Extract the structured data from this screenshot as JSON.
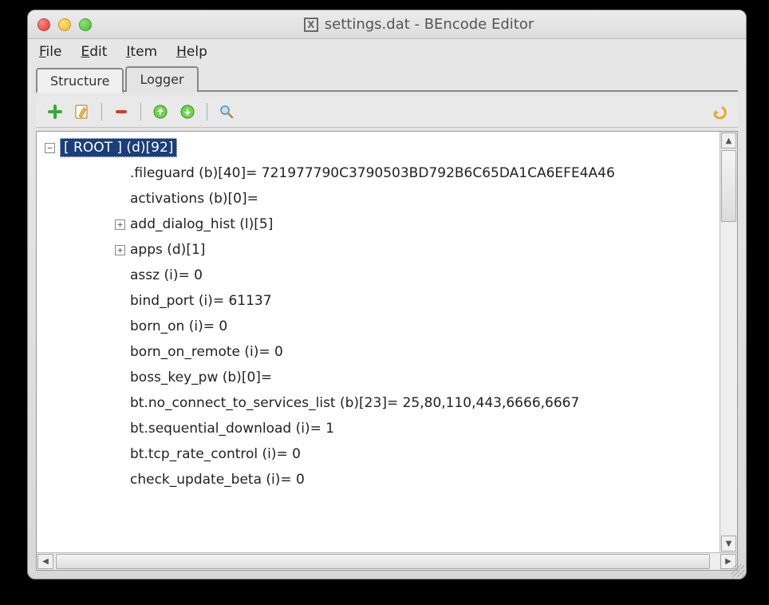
{
  "window": {
    "app_icon_letter": "X",
    "title": "settings.dat - BEncode Editor"
  },
  "menu": {
    "items": [
      {
        "key": "F",
        "rest": "ile"
      },
      {
        "key": "E",
        "rest": "dit"
      },
      {
        "key": "I",
        "rest": "tem"
      },
      {
        "key": "H",
        "rest": "elp"
      }
    ]
  },
  "tabs": {
    "items": [
      "Structure",
      "Logger"
    ],
    "active": 0
  },
  "toolbar": {
    "add": "add-icon",
    "edit": "edit-icon",
    "remove": "remove-icon",
    "up": "up-icon",
    "down": "down-icon",
    "find": "find-icon",
    "undo": "undo-icon"
  },
  "tree": {
    "root_label": "[ ROOT ] (d)[92]",
    "nodes": [
      {
        "expander": null,
        "indent": 2,
        "text": ".fileguard (b)[40]= 721977790C3790503BD792B6C65DA1CA6EFE4A46"
      },
      {
        "expander": null,
        "indent": 2,
        "text": "activations (b)[0]="
      },
      {
        "expander": "+",
        "indent": 2,
        "text": "add_dialog_hist (l)[5]"
      },
      {
        "expander": "+",
        "indent": 2,
        "text": "apps (d)[1]"
      },
      {
        "expander": null,
        "indent": 2,
        "text": "assz (i)= 0"
      },
      {
        "expander": null,
        "indent": 2,
        "text": "bind_port (i)= 61137"
      },
      {
        "expander": null,
        "indent": 2,
        "text": "born_on (i)= 0"
      },
      {
        "expander": null,
        "indent": 2,
        "text": "born_on_remote (i)= 0"
      },
      {
        "expander": null,
        "indent": 2,
        "text": "boss_key_pw (b)[0]="
      },
      {
        "expander": null,
        "indent": 2,
        "text": "bt.no_connect_to_services_list (b)[23]= 25,80,110,443,6666,6667"
      },
      {
        "expander": null,
        "indent": 2,
        "text": "bt.sequential_download (i)= 1"
      },
      {
        "expander": null,
        "indent": 2,
        "text": "bt.tcp_rate_control (i)= 0"
      },
      {
        "expander": null,
        "indent": 2,
        "text": "check_update_beta (i)= 0"
      }
    ]
  }
}
